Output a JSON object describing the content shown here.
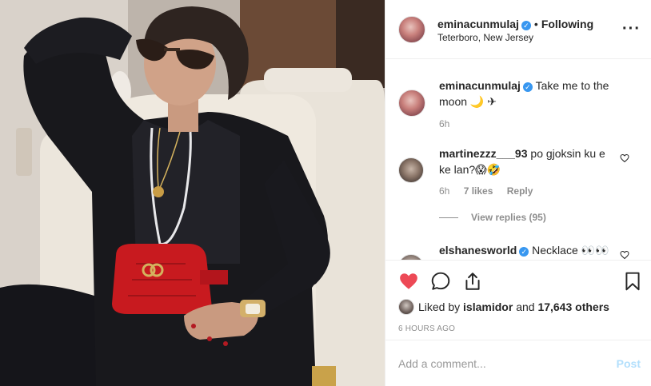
{
  "photo": {
    "alt": ""
  },
  "header": {
    "username": "eminacunmulaj",
    "separator": "•",
    "follow_status": "Following",
    "location": "Teterboro, New Jersey",
    "more_icon": "more-horizontal-icon"
  },
  "caption": {
    "username": "eminacunmulaj",
    "text": "Take me to the moon 🌙 ✈",
    "time": "6h"
  },
  "comments": [
    {
      "username": "martinezzz___93",
      "text": "po gjoksin ku e ke lan?😱🤣",
      "time": "6h",
      "likes": "7 likes",
      "reply": "Reply",
      "view_replies": "View replies (95)"
    },
    {
      "username": "elshanesworld",
      "text": "Necklace 👀👀"
    }
  ],
  "actions": {
    "like_icon": "heart-filled-icon",
    "comment_icon": "comment-icon",
    "share_icon": "share-icon",
    "save_icon": "bookmark-icon"
  },
  "likes": {
    "prefix": "Liked by",
    "user": "islamidor",
    "middle": "and",
    "others": "17,643 others"
  },
  "post_time": "6 HOURS AGO",
  "add_comment": {
    "placeholder": "Add a comment...",
    "post_label": "Post"
  },
  "colors": {
    "like_red": "#ed4956",
    "verified_blue": "#3897f0",
    "post_disabled": "#b2dffc"
  }
}
